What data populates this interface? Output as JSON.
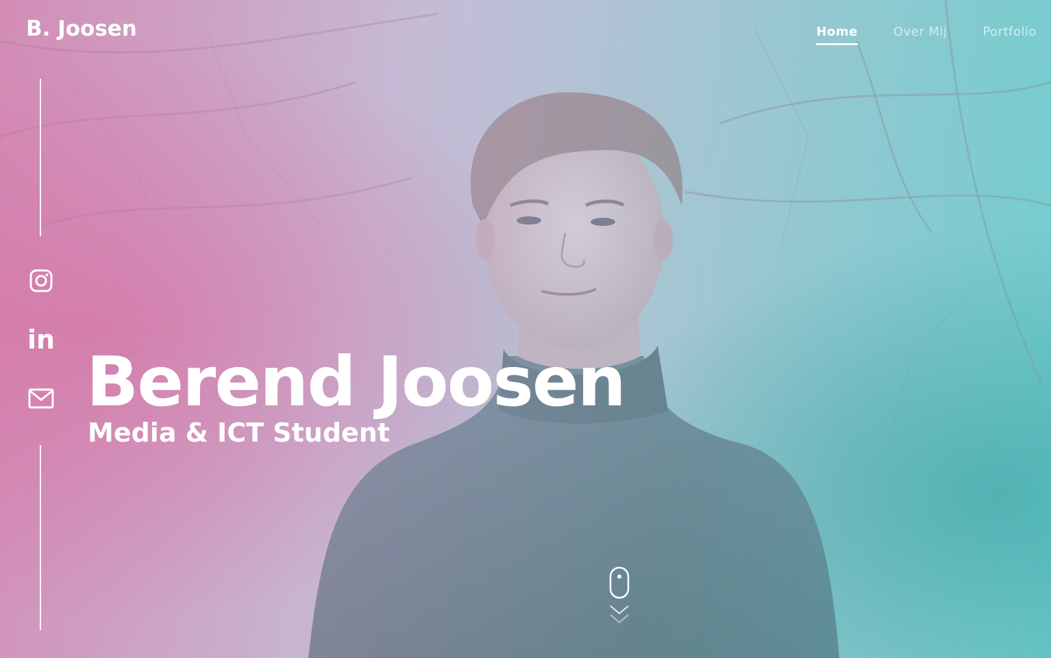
{
  "brand": {
    "logo_text": "B. Joosen"
  },
  "nav": {
    "items": [
      {
        "label": "Home",
        "active": true
      },
      {
        "label": "Over Mij",
        "active": false
      },
      {
        "label": "Portfolio",
        "active": false
      }
    ]
  },
  "social": {
    "instagram_icon": "instagram-icon",
    "linkedin_text": "in",
    "mail_icon": "mail-icon"
  },
  "hero": {
    "name": "Berend Joosen",
    "tagline": "Media & ICT Student"
  },
  "scroll_indicator": {
    "icon": "mouse-scroll-icon"
  },
  "colors": {
    "text": "#ffffff",
    "overlay_left": "#d678aa",
    "overlay_right": "#50c8c8"
  }
}
